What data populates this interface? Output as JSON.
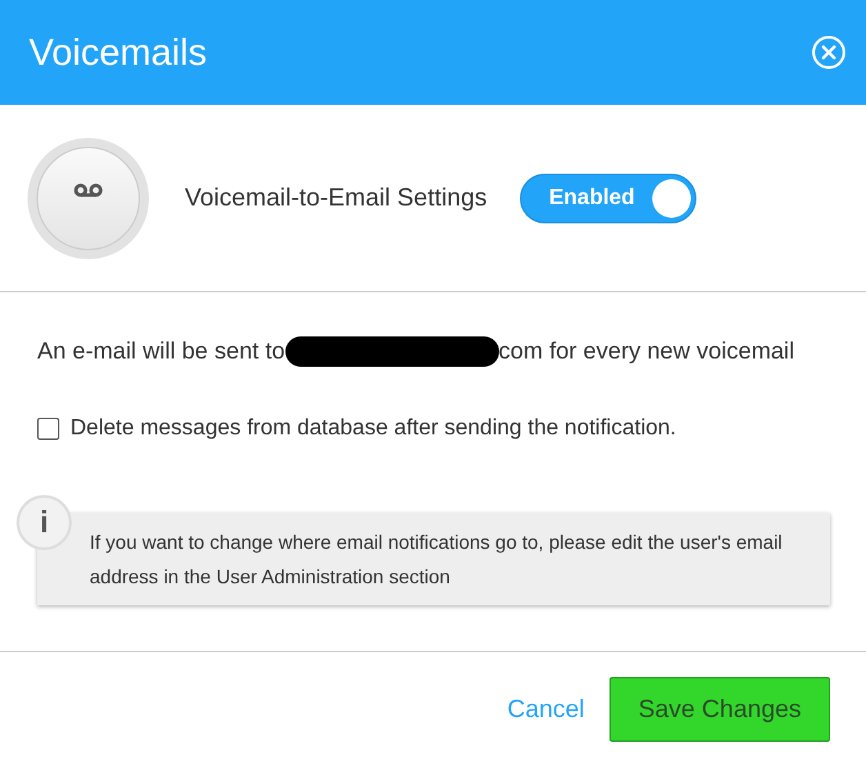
{
  "window": {
    "title": "Voicemails"
  },
  "settings": {
    "label": "Voicemail-to-Email Settings",
    "toggle": {
      "label": "Enabled",
      "on": true
    }
  },
  "notice": {
    "before": "An e-mail will be sent to",
    "after": "com for every new voicemail"
  },
  "delete_option": {
    "label": "Delete messages from database after sending the notification.",
    "checked": false
  },
  "info": {
    "icon": "i",
    "text": "If you want to change where email notifications go to, please edit the user's email address in the User Administration section"
  },
  "buttons": [
    {
      "label": "Cancel",
      "kind": "link"
    },
    {
      "label": "Save Changes",
      "kind": "primary"
    }
  ]
}
